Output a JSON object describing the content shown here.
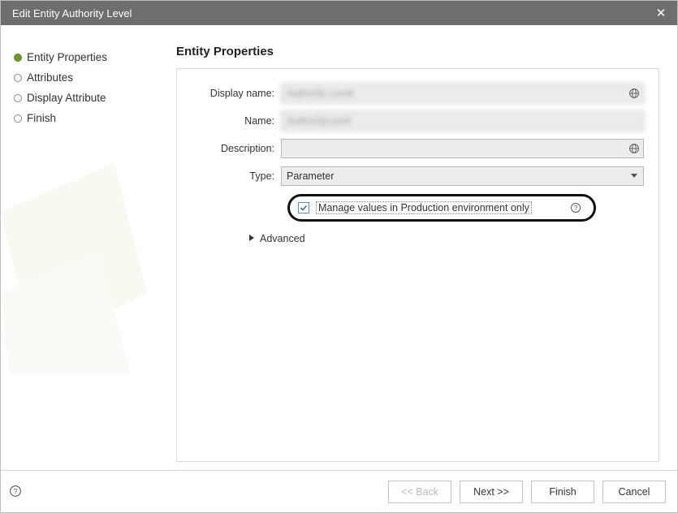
{
  "title": "Edit Entity Authority Level",
  "sidebar": {
    "items": [
      {
        "label": "Entity Properties",
        "current": true
      },
      {
        "label": "Attributes",
        "current": false
      },
      {
        "label": "Display Attribute",
        "current": false
      },
      {
        "label": "Finish",
        "current": false
      }
    ]
  },
  "panel": {
    "heading": "Entity Properties",
    "display_name_label": "Display name:",
    "display_name_value": "Authority Level",
    "name_label": "Name:",
    "name_value": "AuthorityLevel",
    "description_label": "Description:",
    "description_value": "",
    "type_label": "Type:",
    "type_value": "Parameter",
    "checkbox_label": "Manage values in Production environment only",
    "checkbox_checked": true,
    "advanced_label": "Advanced"
  },
  "footer": {
    "back": "<< Back",
    "next": "Next >>",
    "finish": "Finish",
    "cancel": "Cancel"
  }
}
